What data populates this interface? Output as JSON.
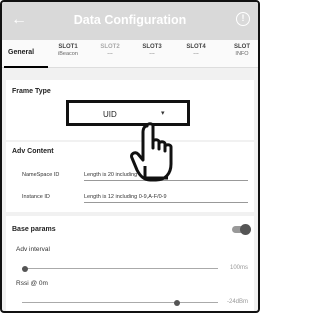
{
  "appbar": {
    "title": "Data Configuration",
    "back_icon": "arrow-left-icon",
    "info_icon": "info-icon"
  },
  "tabs": [
    {
      "label": "General",
      "sub": ""
    },
    {
      "label": "SLOT1",
      "sub": "iBeacon"
    },
    {
      "label": "SLOT2",
      "sub": "---"
    },
    {
      "label": "SLOT3",
      "sub": "---"
    },
    {
      "label": "SLOT4",
      "sub": "---"
    },
    {
      "label": "SLOT",
      "sub": "INFO"
    }
  ],
  "frame_type": {
    "heading": "Frame Type",
    "selected": "UID"
  },
  "adv_content": {
    "heading": "Adv Content",
    "fields": [
      {
        "label": "NameSpace ID",
        "value": "Length is 20 including 0-9,A-F/0-9"
      },
      {
        "label": "Instance ID",
        "value": "Length is 12 including 0-9,A-F/0-9"
      }
    ]
  },
  "base_params": {
    "heading": "Base params",
    "toggle_on": true,
    "sliders": [
      {
        "label": "Adv interval",
        "value": "100ms",
        "level": 0.0
      },
      {
        "label": "Rssi @ 0m",
        "value": "-24dBm",
        "level": 0.8
      }
    ]
  },
  "colors": {
    "appbar": "#d9d9d9",
    "background": "#f1f1f1",
    "accent": "#111111"
  }
}
